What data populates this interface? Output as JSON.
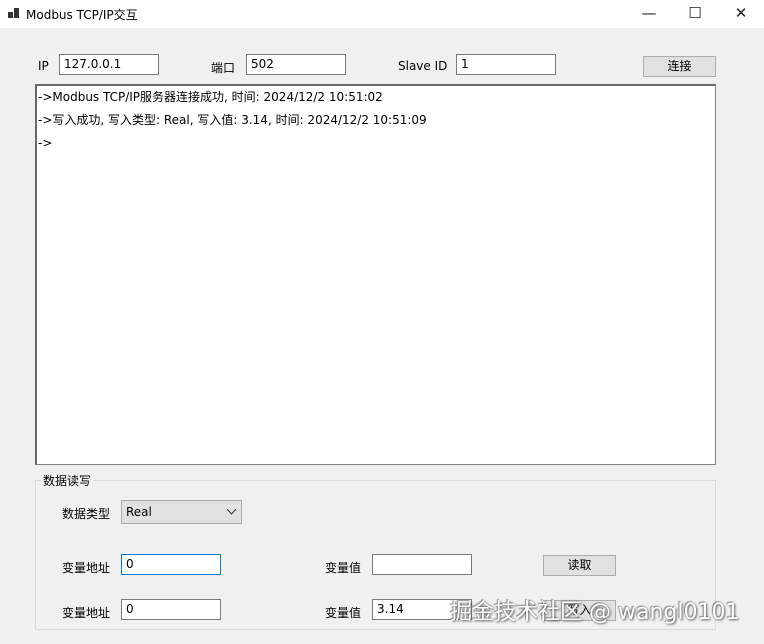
{
  "window": {
    "title": "Modbus TCP/IP交互",
    "minimize": "—",
    "maximize": "☐",
    "close": "✕"
  },
  "conn": {
    "ip_label": "IP",
    "ip": "127.0.0.1",
    "port_label": "端口",
    "port": "502",
    "slave_label": "Slave ID",
    "slave": "1",
    "connect": "连接"
  },
  "log": [
    "->Modbus TCP/IP服务器连接成功, 时间: 2024/12/2 10:51:02",
    "->写入成功, 写入类型: Real, 写入值: 3.14, 时间: 2024/12/2 10:51:09",
    "->"
  ],
  "rw": {
    "legend": "数据读写",
    "type_label": "数据类型",
    "type": "Real",
    "read": {
      "addr_label": "变量地址",
      "addr": "0",
      "val_label": "变量值",
      "val": "",
      "button": "读取"
    },
    "write": {
      "addr_label": "变量地址",
      "addr": "0",
      "val_label": "变量值",
      "val": "3.14",
      "button": "写入"
    }
  },
  "watermark": "掘金技术社区 @ wangl0101"
}
